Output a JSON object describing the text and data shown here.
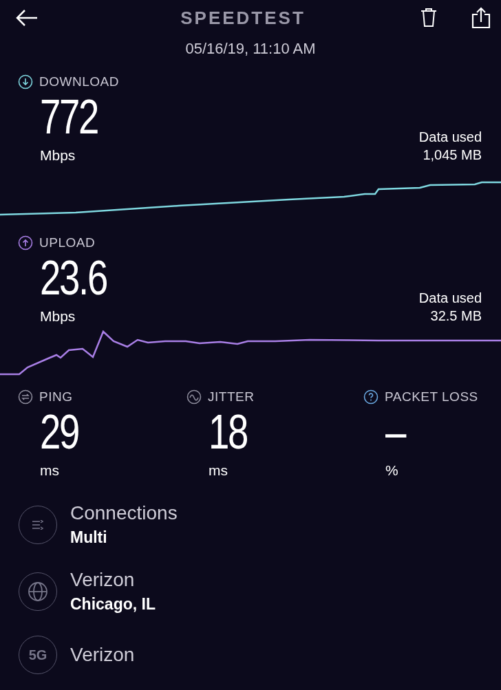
{
  "header": {
    "title": "SPEEDTEST",
    "date": "05/16/19, 11:10 AM"
  },
  "tests": [
    {
      "kind": "download",
      "label": "DOWNLOAD",
      "value": "772",
      "unit": "Mbps",
      "data_label": "Data used",
      "data_value": "1,045 MB",
      "color": "#7fd8e0"
    },
    {
      "kind": "upload",
      "label": "UPLOAD",
      "value": "23.6",
      "unit": "Mbps",
      "data_label": "Data used",
      "data_value": "32.5 MB",
      "color": "#a97fe6"
    }
  ],
  "stats": [
    {
      "kind": "ping",
      "label": "PING",
      "value": "29",
      "unit": "ms"
    },
    {
      "kind": "jitter",
      "label": "JITTER",
      "value": "18",
      "unit": "ms"
    },
    {
      "kind": "packet_loss",
      "label": "PACKET LOSS",
      "value": "–",
      "unit": "%"
    }
  ],
  "details": [
    {
      "kind": "connections",
      "title": "Connections",
      "subtitle": "Multi"
    },
    {
      "kind": "globe",
      "title": "Verizon",
      "subtitle": "Chicago, IL"
    },
    {
      "kind": "network",
      "icon_text": "5G",
      "title": "Verizon"
    }
  ]
}
